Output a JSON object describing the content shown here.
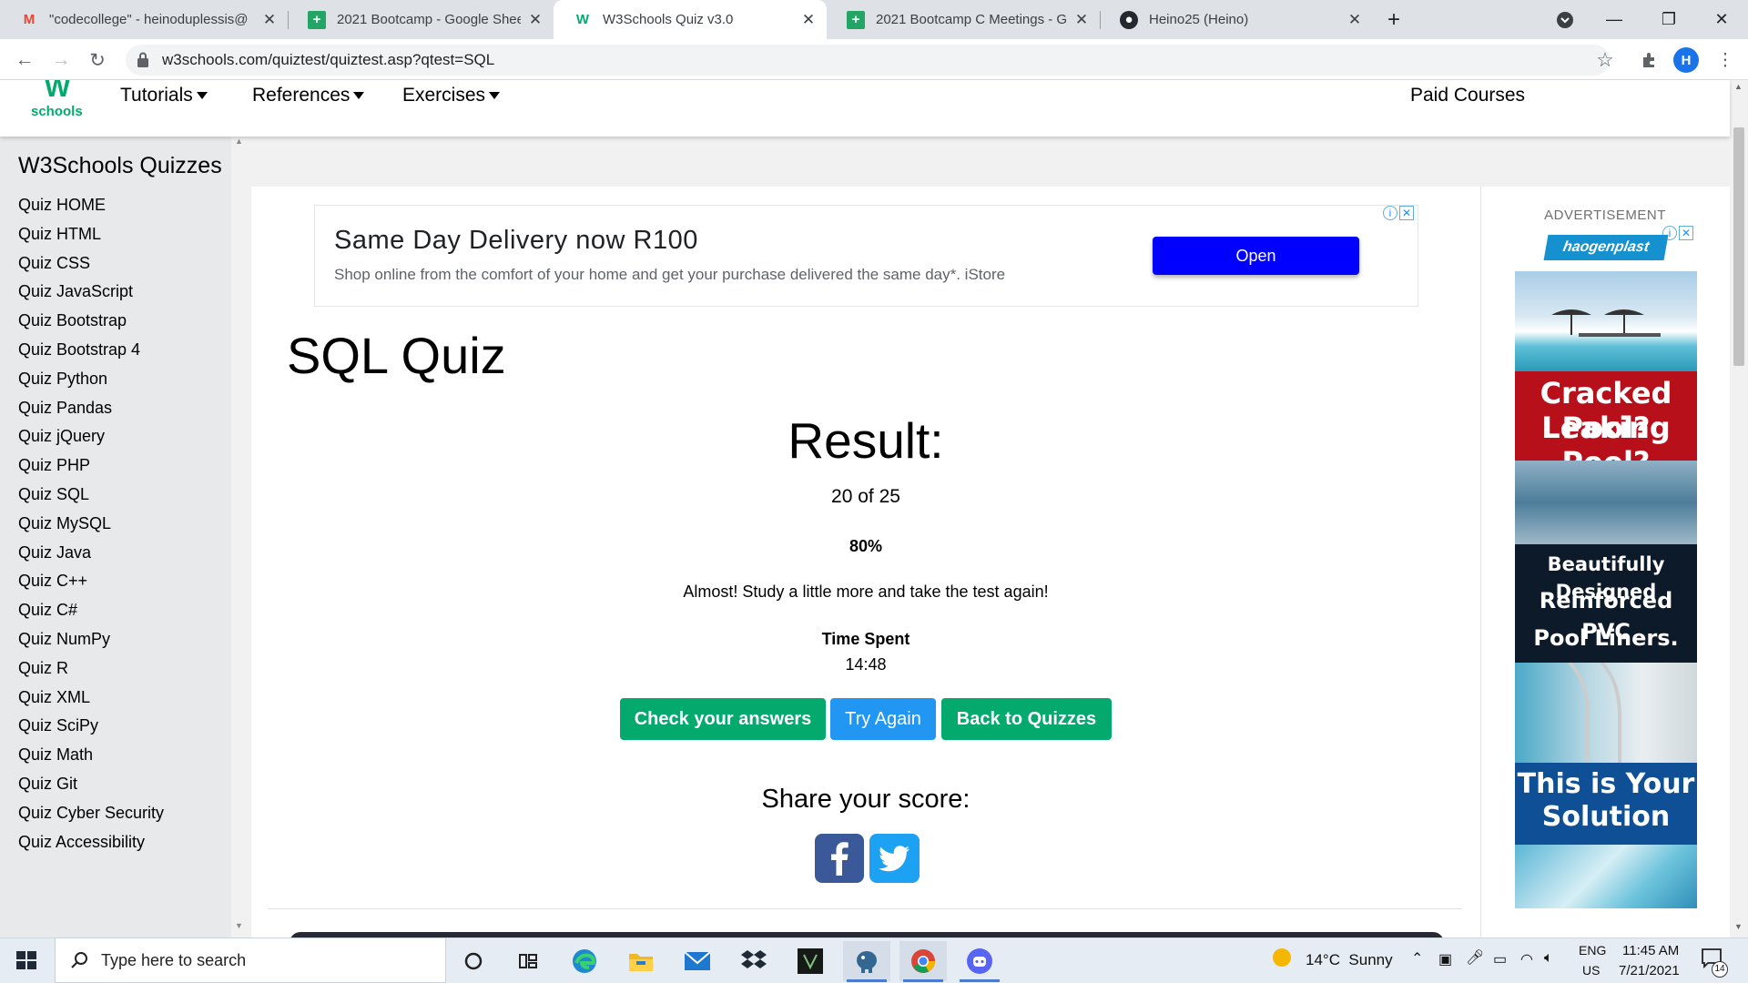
{
  "browser": {
    "tabs": [
      {
        "title": "\"codecollege\" - heinoduplessis@",
        "favicon": "gmail-icon",
        "active": false
      },
      {
        "title": "2021 Bootcamp - Google Sheets",
        "favicon": "sheets-icon",
        "active": false
      },
      {
        "title": "W3Schools Quiz v3.0",
        "favicon": "w3schools-icon",
        "active": true
      },
      {
        "title": "2021 Bootcamp C Meetings - Go",
        "favicon": "sheets-icon",
        "active": false
      },
      {
        "title": "Heino25 (Heino)",
        "favicon": "github-icon",
        "active": false
      }
    ],
    "url": "w3schools.com/quiztest/quiztest.asp?qtest=SQL",
    "profile_initial": "H"
  },
  "header": {
    "logo_text": "schools",
    "logo_mark": "W",
    "nav": [
      "Tutorials",
      "References",
      "Exercises"
    ],
    "paid_courses": "Paid Courses"
  },
  "sidebar": {
    "title": "W3Schools Quizzes",
    "items": [
      "Quiz HOME",
      "Quiz HTML",
      "Quiz CSS",
      "Quiz JavaScript",
      "Quiz Bootstrap",
      "Quiz Bootstrap 4",
      "Quiz Python",
      "Quiz Pandas",
      "Quiz jQuery",
      "Quiz PHP",
      "Quiz SQL",
      "Quiz MySQL",
      "Quiz Java",
      "Quiz C++",
      "Quiz C#",
      "Quiz NumPy",
      "Quiz R",
      "Quiz XML",
      "Quiz SciPy",
      "Quiz Math",
      "Quiz Git",
      "Quiz Cyber Security",
      "Quiz Accessibility"
    ]
  },
  "ad_top": {
    "headline": "Same Day Delivery now R100",
    "text": "Shop online from the comfort of your home and get your purchase delivered the same day*. iStore",
    "button": "Open"
  },
  "main": {
    "title": "SQL Quiz",
    "result_heading": "Result:",
    "score": "20 of 25",
    "percent": "80%",
    "message": "Almost! Study a little more and take the test again!",
    "time_label": "Time Spent",
    "time_value": "14:48",
    "buttons": {
      "check": "Check your answers",
      "try_again": "Try Again",
      "back": "Back to Quizzes"
    },
    "share_heading": "Share your score:"
  },
  "ad_right": {
    "label": "ADVERTISEMENT",
    "brand": "haogenplast",
    "line1": "Cracked Pool?",
    "line2": "Leaking Pool?",
    "line3": "Beautifully Designed",
    "line4": "Reinforced PVC",
    "line5": "Pool Liners.",
    "line6": "This is Your",
    "line7": "Solution"
  },
  "taskbar": {
    "search_placeholder": "Type here to search",
    "weather": "14°C  Sunny",
    "lang1": "ENG",
    "lang2": "US",
    "time": "11:45 AM",
    "date": "7/21/2021",
    "notifications": "14"
  },
  "colors": {
    "w3_green": "#04aa6d",
    "try_again_blue": "#2196f3",
    "ad_button_blue": "#0000ff"
  }
}
